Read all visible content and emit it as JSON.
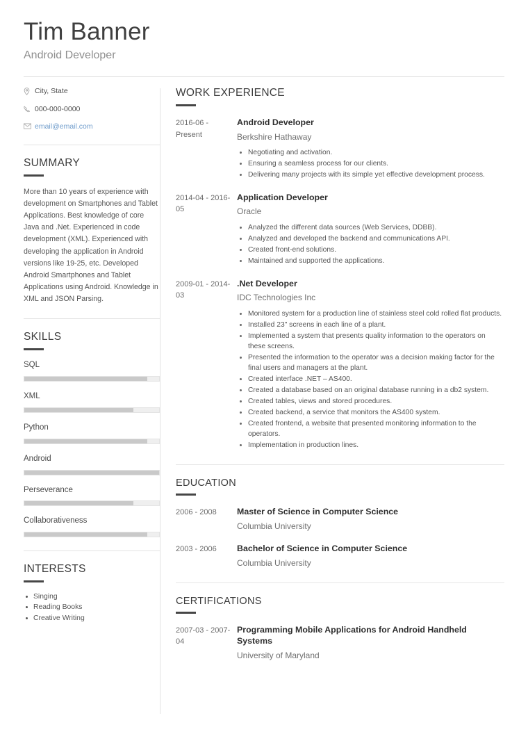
{
  "header": {
    "name": "Tim Banner",
    "title": "Android Developer"
  },
  "contact": {
    "location": {
      "icon": "location-pin-icon",
      "text": "City, State"
    },
    "phone": {
      "icon": "phone-icon",
      "text": "000-000-0000"
    },
    "email": {
      "icon": "envelope-icon",
      "text": "email@email.com",
      "color": "#6f9ccb"
    }
  },
  "sidebar": {
    "summary": {
      "heading": "SUMMARY",
      "text": "More than 10 years of experience with development on Smartphones and Tablet Applications. Best knowledge of core Java and .Net. Experienced in code development (XML). Experienced with developing the application in Android versions like 19-25, etc. Developed Android Smartphones and Tablet Applications using Android. Knowledge in XML and JSON Parsing."
    },
    "skills": {
      "heading": "SKILLS",
      "items": [
        {
          "name": "SQL",
          "level": 91
        },
        {
          "name": "XML",
          "level": 81
        },
        {
          "name": "Python",
          "level": 91
        },
        {
          "name": "Android",
          "level": 100
        },
        {
          "name": "Perseverance",
          "level": 81
        },
        {
          "name": "Collaborativeness",
          "level": 91
        }
      ]
    },
    "interests": {
      "heading": "INTERESTS",
      "items": [
        "Singing",
        "Reading Books",
        "Creative Writing"
      ]
    }
  },
  "main": {
    "work": {
      "heading": "WORK EXPERIENCE",
      "entries": [
        {
          "date": "2016-06 - Present",
          "role": "Android Developer",
          "org": "Berkshire Hathaway",
          "bullets": [
            "Negotiating and activation.",
            "Ensuring a seamless process for our clients.",
            "Delivering many projects with its simple yet effective development process."
          ]
        },
        {
          "date": "2014-04 - 2016-05",
          "role": "Application Developer",
          "org": "Oracle",
          "bullets": [
            "Analyzed the different data sources (Web Services, DDBB).",
            "Analyzed and developed the backend and communications API.",
            "Created front-end solutions.",
            "Maintained and supported the applications."
          ]
        },
        {
          "date": "2009-01 - 2014-03",
          "role": ".Net Developer",
          "org": "IDC Technologies Inc",
          "bullets": [
            "Monitored system for a production line of stainless steel cold rolled flat products.",
            "Installed 23\" screens in each line of a plant.",
            "Implemented a system that presents quality information to the operators on these screens.",
            "Presented the information to the operator was a decision making factor for the final users and managers at the plant.",
            "Created interface .NET – AS400.",
            "Created a database based on an original database running in a db2 system.",
            "Created tables, views and stored procedures.",
            "Created backend, a service that monitors the AS400 system.",
            "Created frontend, a website that presented monitoring information to the operators.",
            "Implementation in production lines."
          ]
        }
      ]
    },
    "education": {
      "heading": "EDUCATION",
      "entries": [
        {
          "date": "2006 - 2008",
          "role": "Master of Science in Computer Science",
          "org": "Columbia University"
        },
        {
          "date": "2003 - 2006",
          "role": "Bachelor of Science in Computer Science",
          "org": "Columbia University"
        }
      ]
    },
    "certifications": {
      "heading": "CERTIFICATIONS",
      "entries": [
        {
          "date": "2007-03 - 2007-04",
          "role": "Programming Mobile Applications for Android Handheld Systems",
          "org": "University of Maryland"
        }
      ]
    }
  }
}
